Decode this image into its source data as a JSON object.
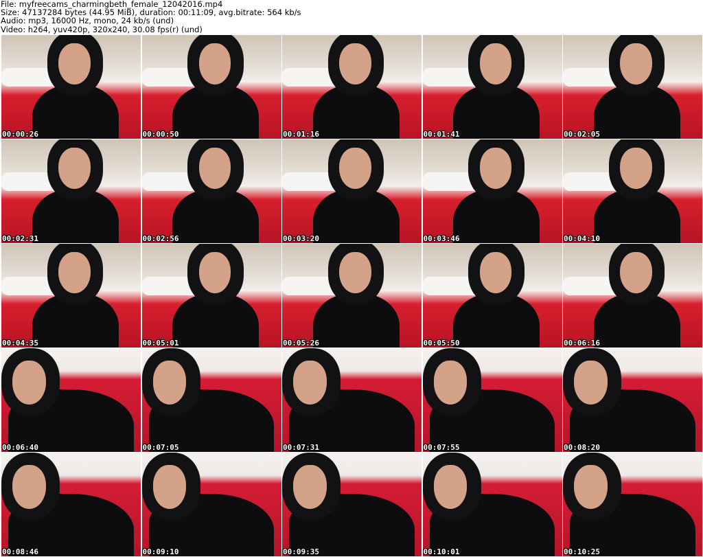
{
  "info": {
    "file": "File: myfreecams_charmingbeth_female_12042016.mp4",
    "size": "Size: 47137284 bytes (44.95 MiB), duration: 00:11:09, avg.bitrate: 564 kb/s",
    "audio": "Audio: mp3, 16000 Hz, mono, 24 kb/s (und)",
    "video": "Video: h264, yuv420p, 320x240, 30.08 fps(r) (und)"
  },
  "thumbnails": [
    "00:00:26",
    "00:00:50",
    "00:01:16",
    "00:01:41",
    "00:02:05",
    "00:02:31",
    "00:02:56",
    "00:03:20",
    "00:03:46",
    "00:04:10",
    "00:04:35",
    "00:05:01",
    "00:05:26",
    "00:05:50",
    "00:06:16",
    "00:06:40",
    "00:07:05",
    "00:07:31",
    "00:07:55",
    "00:08:20",
    "00:08:46",
    "00:09:10",
    "00:09:35",
    "00:10:01",
    "00:10:25"
  ]
}
